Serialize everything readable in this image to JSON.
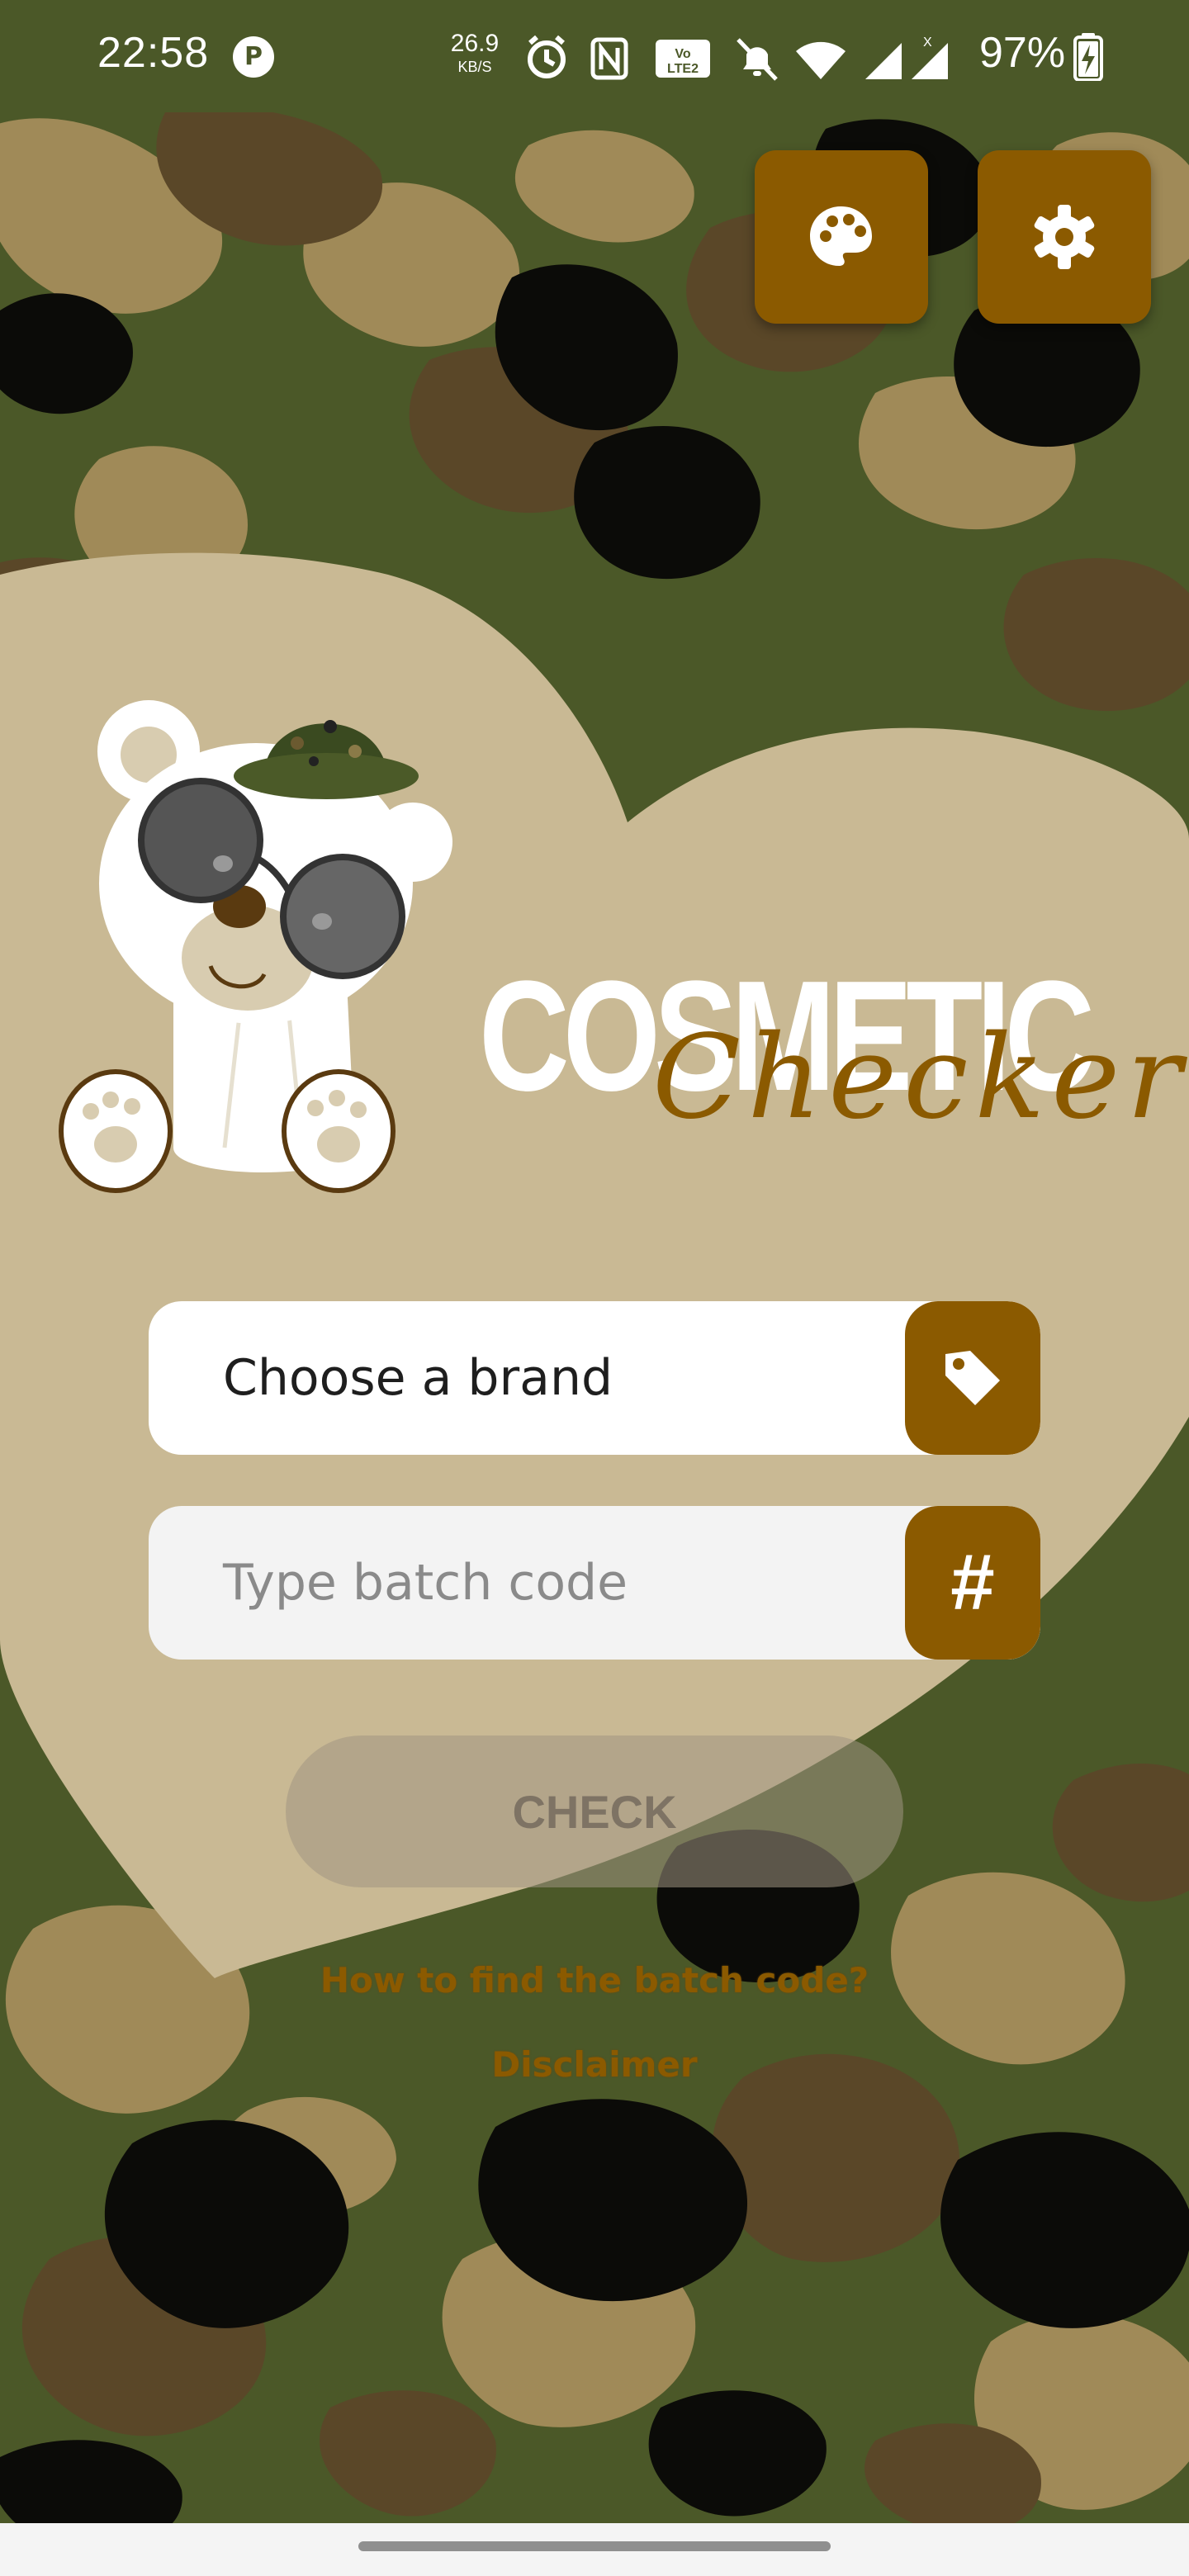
{
  "status_bar": {
    "time": "22:58",
    "speed_value": "26.9",
    "speed_unit": "KB/S",
    "battery_percent": "97%",
    "icons": [
      "notification-p-icon",
      "alarm-icon",
      "nfc-icon",
      "volte-icon",
      "mute-icon",
      "wifi-icon",
      "signal-icon",
      "signal-x-icon",
      "battery-charging-icon"
    ]
  },
  "toolbar": {
    "palette_icon": "palette-icon",
    "settings_icon": "gear-icon"
  },
  "logo": {
    "word1": "COSMETIC",
    "word2": "Checker"
  },
  "form": {
    "brand_label": "Choose a brand",
    "brand_icon": "tag-icon",
    "batch_placeholder": "Type batch code",
    "batch_icon": "#",
    "check_label": "CHECK"
  },
  "links": {
    "howto": "How to find the batch code?",
    "disclaimer": "Disclaimer"
  },
  "colors": {
    "accent": "#8b5a00",
    "heart": "#c9b994",
    "camo_dark": "#4b5828"
  }
}
